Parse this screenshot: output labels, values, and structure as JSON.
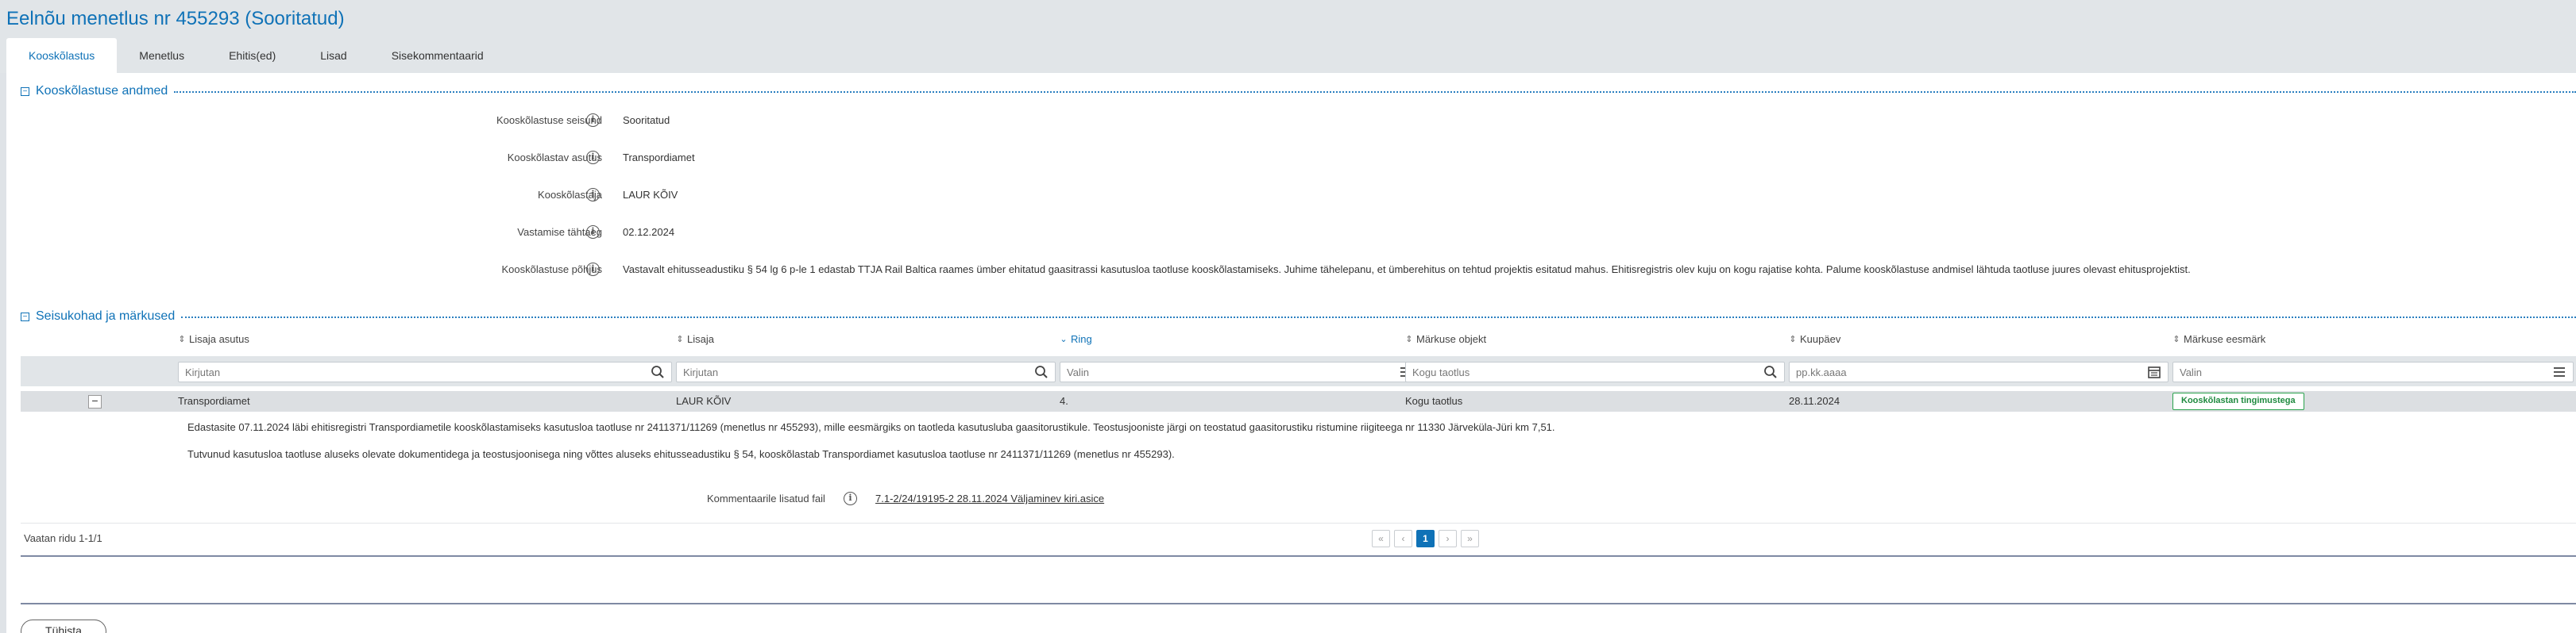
{
  "header": {
    "title": "Eelnõu menetlus nr 455293 (Sooritatud)",
    "tabs": [
      {
        "label": "Kooskõlastus",
        "active": true
      },
      {
        "label": "Menetlus"
      },
      {
        "label": "Ehitis(ed)"
      },
      {
        "label": "Lisad"
      },
      {
        "label": "Sisekommentaarid"
      }
    ]
  },
  "section1": {
    "toggle": "−",
    "title": "Kooskõlastuse andmed",
    "fields": [
      {
        "label": "Kooskõlastuse seisund",
        "value": "Sooritatud"
      },
      {
        "label": "Kooskõlastav asutus",
        "value": "Transpordiamet"
      },
      {
        "label": "Kooskõlastaja",
        "value": "LAUR KÕIV"
      },
      {
        "label": "Vastamise tähtaeg",
        "value": "02.12.2024"
      },
      {
        "label": "Kooskõlastuse põhjus",
        "value": "Vastavalt ehitusseadustiku § 54 lg 6 p-le 1 edastab TTJA Rail Baltica raames ümber ehitatud gaasitrassi kasutusloa taotluse kooskõlastamiseks. Juhime tähelepanu, et ümberehitus on tehtud projektis esitatud mahus. Ehitisregistris olev kuju on kogu rajatise kohta. Palume kooskõlastuse andmisel lähtuda taotluse juures olevast ehitusprojektist."
      }
    ]
  },
  "section2": {
    "toggle": "−",
    "title": "Seisukohad ja märkused",
    "columns": [
      {
        "label": "Lisaja asutus",
        "sort": "⇕"
      },
      {
        "label": "Lisaja",
        "sort": "⇕"
      },
      {
        "label": "Ring",
        "sort": "⌄"
      },
      {
        "label": "Märkuse objekt",
        "sort": "⇕"
      },
      {
        "label": "Kuupäev",
        "sort": "⇕"
      },
      {
        "label": "Märkuse eesmärk",
        "sort": "⇕"
      }
    ],
    "filters": [
      {
        "placeholder": "Kirjutan",
        "icon": "search-icon"
      },
      {
        "placeholder": "Kirjutan",
        "icon": "search-icon"
      },
      {
        "placeholder": "Valin",
        "icon": "list-icon"
      },
      {
        "placeholder": "Kogu taotlus",
        "icon": "search-icon"
      },
      {
        "placeholder": "pp.kk.aaaa",
        "icon": "calendar-icon"
      },
      {
        "placeholder": "Valin",
        "icon": "list-icon"
      }
    ],
    "row": {
      "collapse": "−",
      "asutus": "Transpordiamet",
      "lisaja": "LAUR KÕIV",
      "ring": "4.",
      "objekt": "Kogu taotlus",
      "kuupaev": "28.11.2024",
      "eesmark": "Kooskõlastan tingimustega"
    },
    "detail": {
      "line1": "Edastasite 07.11.2024 läbi ehitisregistri Transpordiametile kooskõlastamiseks kasutusloa taotluse nr 2411371/11269 (menetlus nr 455293), mille eesmärgiks on taotleda kasutusluba gaasitorustikule. Teostusjooniste järgi on teostatud gaasitorustiku ristumine riigiteega nr 11330 Järveküla-Jüri km 7,51.",
      "line2": "Tutvunud kasutusloa taotluse aluseks olevate dokumentidega ja teostusjoonisega ning võttes aluseks ehitusseadustiku § 54, kooskõlastab Transpordiamet kasutusloa taotluse nr 2411371/11269 (menetlus nr 455293).",
      "attach_label": "Kommentaarile lisatud fail",
      "attach_link": "7.1-2/24/19195-2 28.11.2024 Väljaminev kiri.asice"
    },
    "footer": {
      "rows_info": "Vaatan ridu 1-1/1",
      "pager": [
        "«",
        "‹",
        "1",
        "›",
        "»"
      ],
      "current_page": "1"
    }
  },
  "back_button": "Tühista"
}
